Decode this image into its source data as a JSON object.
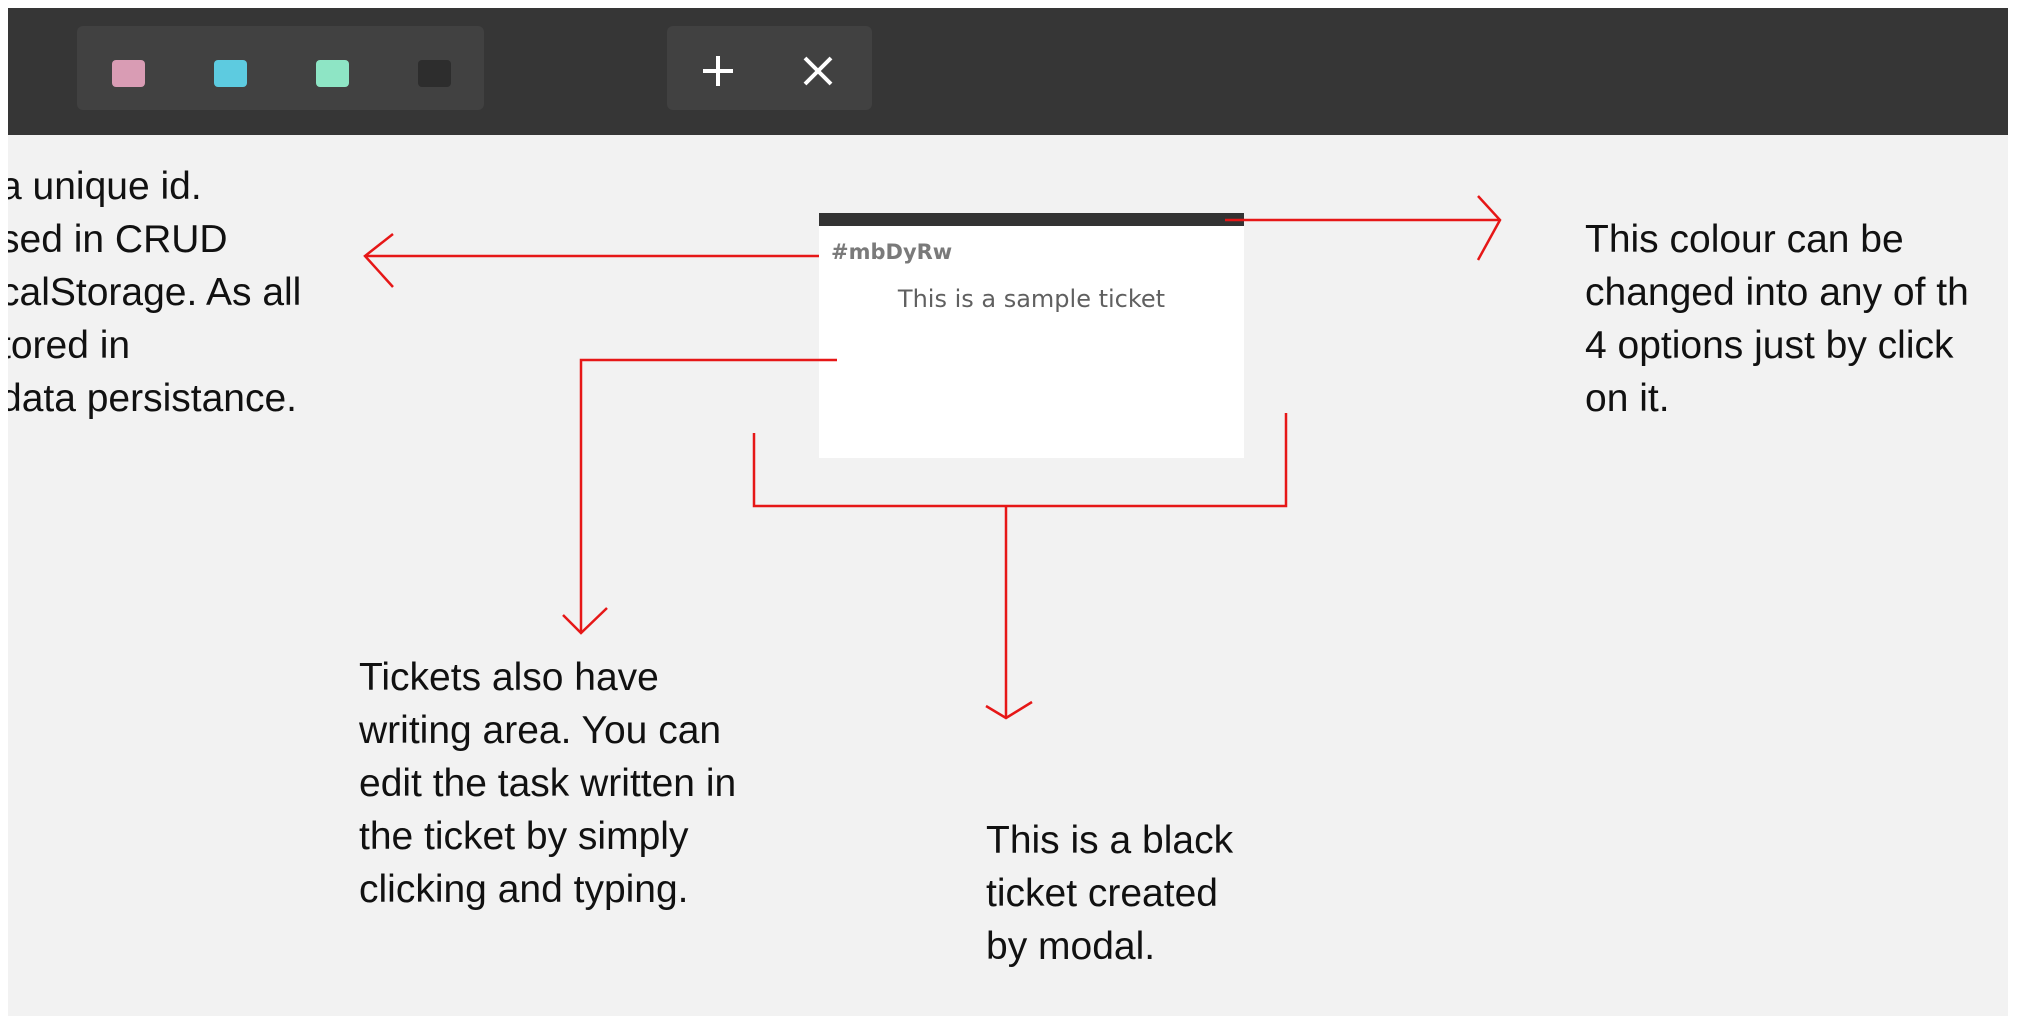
{
  "toolbar": {
    "color_filters": [
      {
        "name": "pink",
        "color": "#d99cb4"
      },
      {
        "name": "blue",
        "color": "#5dcbe0"
      },
      {
        "name": "green",
        "color": "#8ee5c5"
      },
      {
        "name": "black",
        "color": "#2d2d2d"
      }
    ],
    "add_label": "+",
    "remove_label": "✕"
  },
  "ticket": {
    "id": "#mbDyRw",
    "text": "This is a sample ticket",
    "color": "#333333"
  },
  "annotations": {
    "arrow_color": "#e61717",
    "id_note": [
      "a unique id.",
      "sed in CRUD",
      "calStorage. As all",
      "tored in",
      "data persistance."
    ],
    "color_note": [
      "This colour can be",
      "changed into any of th",
      "4 options just by click",
      "on it."
    ],
    "writing_note": [
      "Tickets also have",
      "writing area. You can",
      "edit the task written in",
      "the ticket by simply",
      "clicking and typing."
    ],
    "black_note": [
      "This is a black",
      "ticket created",
      "by modal."
    ]
  }
}
